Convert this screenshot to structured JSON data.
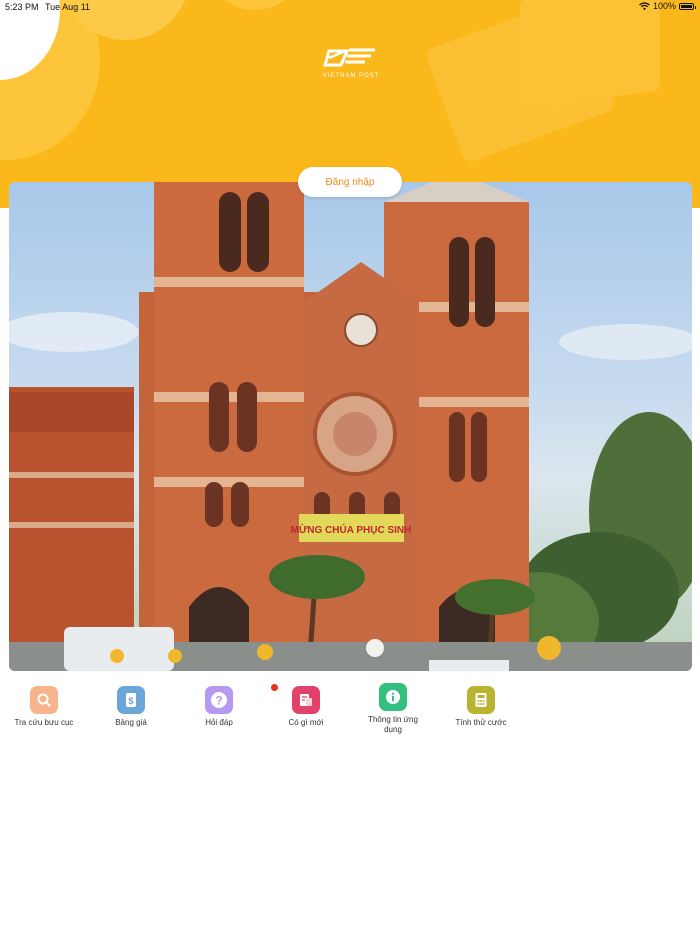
{
  "status_bar": {
    "time": "5:23 PM",
    "date": "Tue Aug 11",
    "battery": "100%",
    "wifi_icon": "wifi-icon",
    "battery_icon": "battery-icon"
  },
  "header": {
    "logo_text": "VIETNAM POST",
    "background_color": "#fbb81b"
  },
  "login": {
    "label": "Đăng nhập",
    "text_color": "#ef8a1a"
  },
  "banner": {
    "sign_text": "MỪNG CHÚA PHỤC SINH"
  },
  "menu": {
    "items": [
      {
        "label": "Tra cứu bưu cục",
        "icon": "search-location-icon",
        "color": "#f6b58c"
      },
      {
        "label": "Bảng giá",
        "icon": "price-list-icon",
        "color": "#6aa6d8"
      },
      {
        "label": "Hỏi đáp",
        "icon": "question-icon",
        "color": "#b69af0"
      },
      {
        "label": "Có gì mới",
        "icon": "news-icon",
        "color": "#e2426a",
        "has_notification": true
      },
      {
        "label": "Thông tin ứng dụng",
        "icon": "info-icon",
        "color": "#33bf80"
      },
      {
        "label": "Tính thử cước",
        "icon": "calculator-icon",
        "color": "#b9b42f"
      }
    ]
  }
}
